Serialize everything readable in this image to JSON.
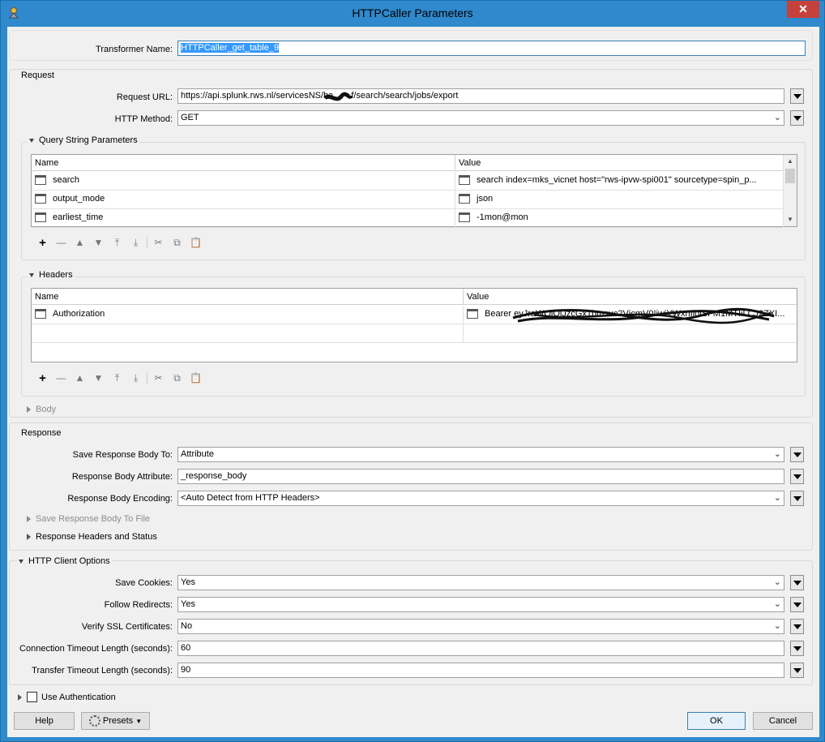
{
  "window": {
    "title": "HTTPCaller Parameters",
    "close_label": "✕"
  },
  "transformer": {
    "label": "Transformer Name:",
    "value": "HTTPCaller_get_table_9"
  },
  "request": {
    "section_title": "Request",
    "url_label": "Request URL:",
    "url_value": "https://api.splunk.rws.nl/servicesNS/ba",
    "url_value_suffix": "f/search/search/jobs/export",
    "method_label": "HTTP Method:",
    "method_value": "GET"
  },
  "query_params": {
    "title": "Query String Parameters",
    "col_name": "Name",
    "col_value": "Value",
    "rows": [
      {
        "name": "search",
        "value": "search index=mks_vicnet host=\"rws-ipvw-spi001\" sourcetype=spin_p..."
      },
      {
        "name": "output_mode",
        "value": "json"
      },
      {
        "name": "earliest_time",
        "value": "-1mon@mon"
      }
    ]
  },
  "headers": {
    "title": "Headers",
    "col_name": "Name",
    "col_value": "Value",
    "rows": [
      {
        "name": "Authorization",
        "value": "Bearer eyJraWQiOiJzcGx1bmsuc2VjcmV0IiwiYWxnIjoiSFM1MTIiLCJ2ZXI..."
      }
    ]
  },
  "toolbar": {
    "add": "+",
    "remove": "—",
    "up": "▲",
    "down": "▼",
    "top": "⤒",
    "bottom": "⤓",
    "cut": "✂",
    "copy": "⧉",
    "paste": "📋"
  },
  "body_section": {
    "title": "Body"
  },
  "response": {
    "section_title": "Response",
    "save_to_label": "Save Response Body To:",
    "save_to_value": "Attribute",
    "attribute_label": "Response Body Attribute:",
    "attribute_value": "_response_body",
    "encoding_label": "Response Body Encoding:",
    "encoding_value": "<Auto Detect from HTTP Headers>",
    "save_to_file": "Save Response Body To File",
    "headers_status": "Response Headers and Status"
  },
  "client": {
    "section_title": "HTTP Client Options",
    "cookies_label": "Save Cookies:",
    "cookies_value": "Yes",
    "redirects_label": "Follow Redirects:",
    "redirects_value": "Yes",
    "ssl_label": "Verify SSL Certificates:",
    "ssl_value": "No",
    "conn_label": "Connection Timeout Length (seconds):",
    "conn_value": "60",
    "transfer_label": "Transfer Timeout Length (seconds):",
    "transfer_value": "90"
  },
  "auth": {
    "label": "Use Authentication"
  },
  "footer": {
    "help": "Help",
    "presets": "Presets",
    "ok": "OK",
    "cancel": "Cancel"
  }
}
